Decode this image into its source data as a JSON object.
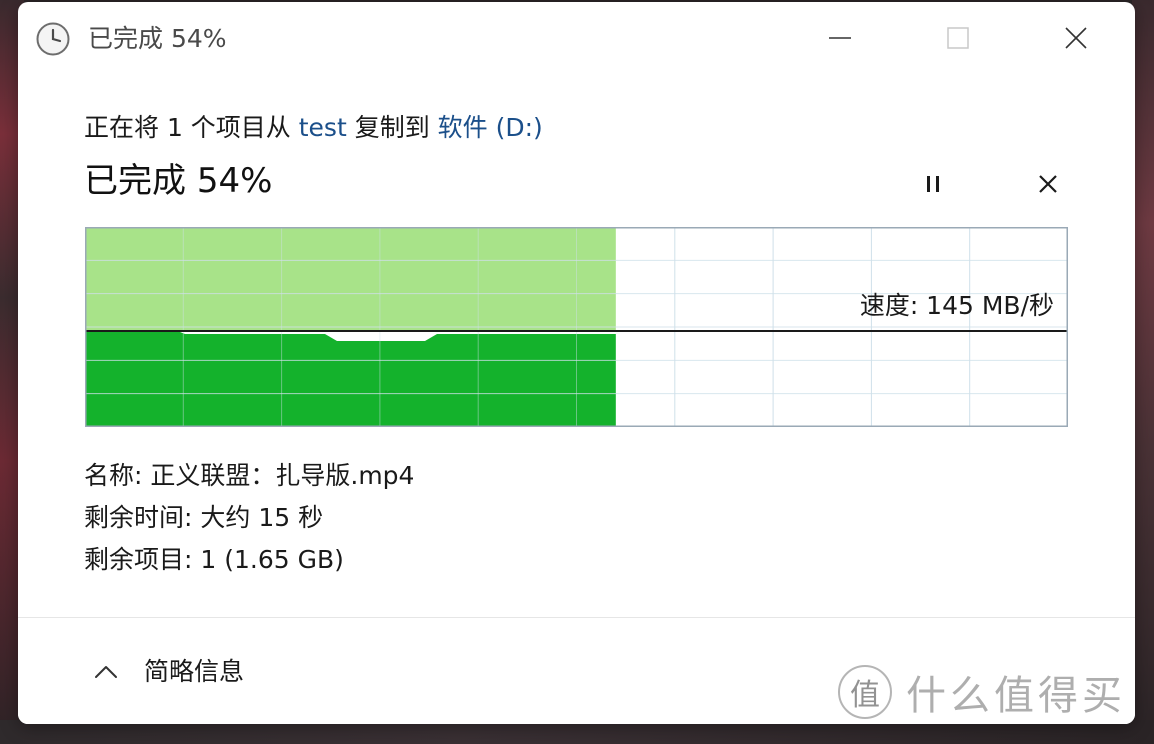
{
  "window": {
    "title": "已完成 54%",
    "icon": "clock-icon"
  },
  "copy": {
    "prefix": "正在将 1 个项目从 ",
    "source": "test",
    "middle": " 复制到 ",
    "destination": "软件 (D:)"
  },
  "progress": {
    "headline_label": "已完成 ",
    "headline_value": "54%",
    "percent": 54
  },
  "graph": {
    "speed_text": "速度: 145 MB/秒",
    "colors": {
      "fill_dark": "#14b22c",
      "fill_light": "#a8e389",
      "line": "#1a1a1a",
      "grid": "#cfe0ea",
      "border": "#9aa9b6"
    }
  },
  "details": {
    "name": "名称:  正义联盟：扎导版.mp4",
    "time_remaining": "剩余时间:  大约 15 秒",
    "items_remaining": "剩余项目:  1 (1.65 GB)"
  },
  "footer": {
    "toggle_label": "简略信息",
    "toggle_icon": "chevron-up-icon"
  },
  "watermark": {
    "badge": "值",
    "text": "什么值得买"
  }
}
